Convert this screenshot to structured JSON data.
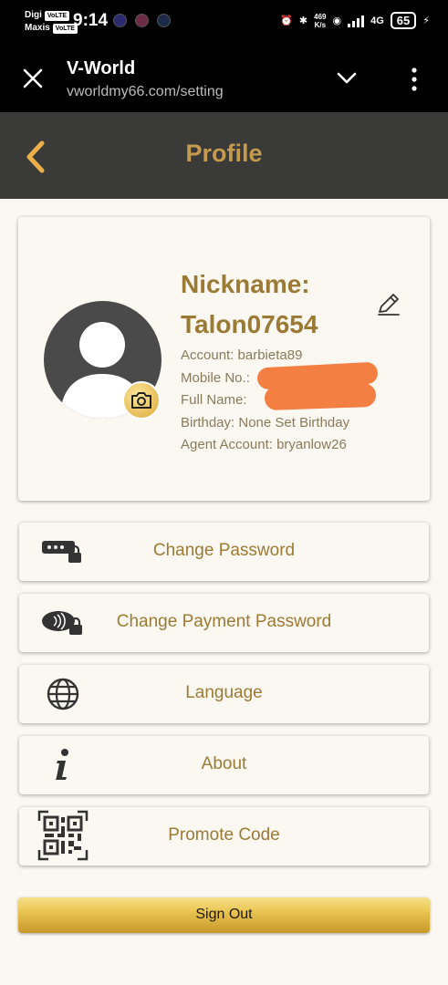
{
  "status_bar": {
    "carrier1": "Digi",
    "carrier2": "Maxis",
    "volte": "VoLTE",
    "time": "9:14",
    "speed_value": "469",
    "speed_unit": "K/s",
    "network": "4G",
    "battery": "65"
  },
  "browser": {
    "title": "V-World",
    "url": "vworldmy66.com/setting"
  },
  "header": {
    "title": "Profile"
  },
  "profile": {
    "nickname_label": "Nickname:",
    "nickname_value": "Talon07654",
    "account": "Account: barbieta89",
    "mobile": "Mobile No.:",
    "full_name": "Full Name:",
    "birthday": "Birthday: None Set Birthday",
    "agent": "Agent Account: bryanlow26"
  },
  "menu": [
    {
      "label": "Change Password",
      "icon": "password-lock-icon"
    },
    {
      "label": "Change Payment Password",
      "icon": "payment-lock-icon"
    },
    {
      "label": "Language",
      "icon": "globe-icon"
    },
    {
      "label": "About",
      "icon": "info-icon"
    },
    {
      "label": "Promote Code",
      "icon": "qr-code-icon"
    }
  ],
  "sign_out": {
    "label": "Sign Out"
  },
  "colors": {
    "accent_gold": "#c49a4f",
    "text_gold": "#9b7a35",
    "header_bg": "#3a3a39",
    "redaction": "#f37f43"
  }
}
